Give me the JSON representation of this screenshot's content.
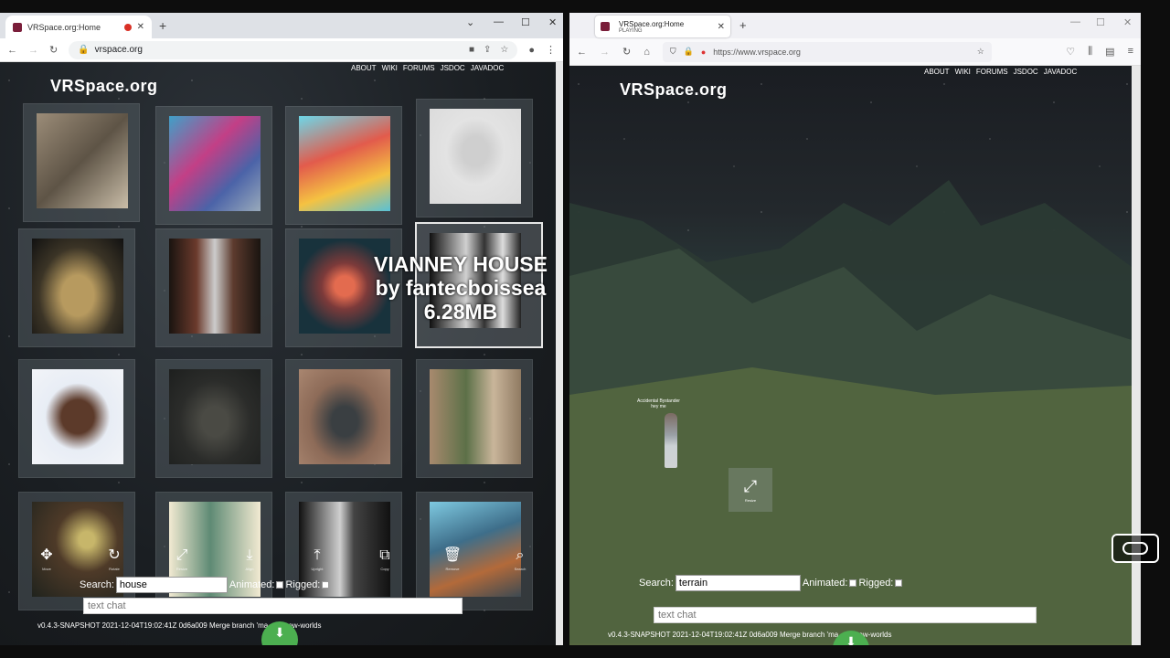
{
  "left": {
    "tab_title": "VRSpace.org:Home",
    "url": "vrspace.org",
    "nav": [
      "ABOUT",
      "WIKI",
      "FORUMS",
      "JSDOC",
      "JAVADOC"
    ],
    "brand": "VRSpace.org",
    "selected_model": {
      "name": "VIANNEY HOUSE",
      "author": "by fantecboissea",
      "size": "6.28MB"
    },
    "tools": [
      {
        "icon": "move-icon",
        "glyph": "✥",
        "label": "Move"
      },
      {
        "icon": "rotate-icon",
        "glyph": "↻",
        "label": "Rotate"
      },
      {
        "icon": "resize-icon",
        "glyph": "⤢",
        "label": "Resize"
      },
      {
        "icon": "align-icon",
        "glyph": "⤓",
        "label": "Align"
      },
      {
        "icon": "upright-icon",
        "glyph": "⤒",
        "label": "Upright"
      },
      {
        "icon": "copy-icon",
        "glyph": "⧉",
        "label": "Copy"
      },
      {
        "icon": "remove-icon",
        "glyph": "🗑",
        "label": "Remove"
      },
      {
        "icon": "search-icon",
        "glyph": "⌕",
        "label": "Search"
      }
    ],
    "search": {
      "label": "Search:",
      "value": "house",
      "animated_label": "Animated:",
      "rigged_label": "Rigged:"
    },
    "chat_placeholder": "text chat",
    "version": "v0.4.3-SNAPSHOT 2021-12-04T19:02:41Z 0d6a009 Merge branch 'ma",
    "version_tail": "o new-worlds",
    "download_glyph": "⬇"
  },
  "right": {
    "tab_title": "VRSpace.org:Home",
    "tab_status": "PLAYING",
    "url": "https://www.vrspace.org",
    "nav": [
      "ABOUT",
      "WIKI",
      "FORUMS",
      "JSDOC",
      "JAVADOC"
    ],
    "brand": "VRSpace.org",
    "avatar_name": "Accidental Bystander",
    "avatar_subtitle": "hey me",
    "resize_glyph": "⤢",
    "resize_label": "Resize",
    "search": {
      "label": "Search:",
      "value": "terrain",
      "animated_label": "Animated:",
      "rigged_label": "Rigged:"
    },
    "chat_placeholder": "text chat",
    "version": "v0.4.3-SNAPSHOT 2021-12-04T19:02:41Z 0d6a009 Merge branch 'ma",
    "version_tail": "o new-worlds",
    "download_glyph": "⬇"
  }
}
